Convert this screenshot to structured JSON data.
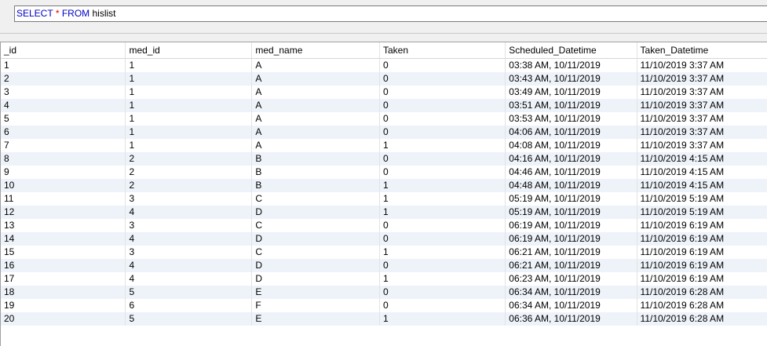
{
  "query": {
    "keyword_select": "SELECT",
    "star": "*",
    "keyword_from": "FROM",
    "table": "hislist"
  },
  "grid": {
    "columns": [
      "_id",
      "med_id",
      "med_name",
      "Taken",
      "Scheduled_Datetime",
      "Taken_Datetime"
    ],
    "rows": [
      [
        "1",
        "1",
        "A",
        "0",
        "03:38 AM, 10/11/2019",
        "11/10/2019 3:37 AM"
      ],
      [
        "2",
        "1",
        "A",
        "0",
        "03:43 AM, 10/11/2019",
        "11/10/2019 3:37 AM"
      ],
      [
        "3",
        "1",
        "A",
        "0",
        "03:49 AM, 10/11/2019",
        "11/10/2019 3:37 AM"
      ],
      [
        "4",
        "1",
        "A",
        "0",
        "03:51 AM, 10/11/2019",
        "11/10/2019 3:37 AM"
      ],
      [
        "5",
        "1",
        "A",
        "0",
        "03:53 AM, 10/11/2019",
        "11/10/2019 3:37 AM"
      ],
      [
        "6",
        "1",
        "A",
        "0",
        "04:06 AM, 10/11/2019",
        "11/10/2019 3:37 AM"
      ],
      [
        "7",
        "1",
        "A",
        "1",
        "04:08 AM, 10/11/2019",
        "11/10/2019 3:37 AM"
      ],
      [
        "8",
        "2",
        "B",
        "0",
        "04:16 AM, 10/11/2019",
        "11/10/2019 4:15 AM"
      ],
      [
        "9",
        "2",
        "B",
        "0",
        "04:46 AM, 10/11/2019",
        "11/10/2019 4:15 AM"
      ],
      [
        "10",
        "2",
        "B",
        "1",
        "04:48 AM, 10/11/2019",
        "11/10/2019 4:15 AM"
      ],
      [
        "11",
        "3",
        "C",
        "1",
        "05:19 AM, 10/11/2019",
        "11/10/2019 5:19 AM"
      ],
      [
        "12",
        "4",
        "D",
        "1",
        "05:19 AM, 10/11/2019",
        "11/10/2019 5:19 AM"
      ],
      [
        "13",
        "3",
        "C",
        "0",
        "06:19 AM, 10/11/2019",
        "11/10/2019 6:19 AM"
      ],
      [
        "14",
        "4",
        "D",
        "0",
        "06:19 AM, 10/11/2019",
        "11/10/2019 6:19 AM"
      ],
      [
        "15",
        "3",
        "C",
        "1",
        "06:21 AM, 10/11/2019",
        "11/10/2019 6:19 AM"
      ],
      [
        "16",
        "4",
        "D",
        "0",
        "06:21 AM, 10/11/2019",
        "11/10/2019 6:19 AM"
      ],
      [
        "17",
        "4",
        "D",
        "1",
        "06:23 AM, 10/11/2019",
        "11/10/2019 6:19 AM"
      ],
      [
        "18",
        "5",
        "E",
        "0",
        "06:34 AM, 10/11/2019",
        "11/10/2019 6:28 AM"
      ],
      [
        "19",
        "6",
        "F",
        "0",
        "06:34 AM, 10/11/2019",
        "11/10/2019 6:28 AM"
      ],
      [
        "20",
        "5",
        "E",
        "1",
        "06:36 AM, 10/11/2019",
        "11/10/2019 6:28 AM"
      ]
    ]
  },
  "colors": {
    "keyword": "#0000c8",
    "operator": "#e00000",
    "alt_row": "#eef3fa"
  }
}
